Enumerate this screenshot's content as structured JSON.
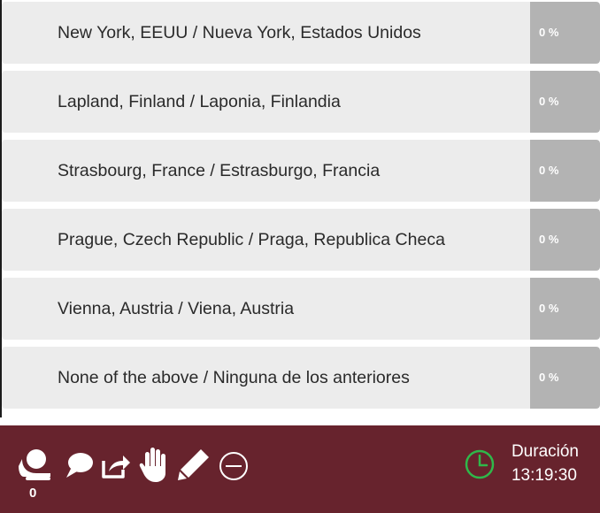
{
  "options": [
    {
      "label": "New York, EEUU / Nueva York, Estados Unidos",
      "percent_text": "0 %",
      "percent_value": 0
    },
    {
      "label": "Lapland, Finland / Laponia, Finlandia",
      "percent_text": "0 %",
      "percent_value": 0
    },
    {
      "label": "Strasbourg, France / Estrasburgo, Francia",
      "percent_text": "0 %",
      "percent_value": 0
    },
    {
      "label": "Prague, Czech Republic / Praga, Republica Checa",
      "percent_text": "0 %",
      "percent_value": 0
    },
    {
      "label": "Vienna, Austria / Viena, Austria",
      "percent_text": "0 %",
      "percent_value": 0
    },
    {
      "label": "None of the above / Ninguna de los anteriores",
      "percent_text": "0 %",
      "percent_value": 0
    }
  ],
  "toolbar": {
    "participants_count": "0",
    "icons": [
      "participants-icon",
      "chat-icon",
      "share-icon",
      "raise-hand-icon",
      "pencil-icon",
      "minus-circle-icon"
    ],
    "duration_label": "Duración",
    "duration_time": "13:19:30"
  },
  "colors": {
    "toolbar_background": "#67232d",
    "option_background": "#ececec",
    "percent_background": "#b3b3b3",
    "clock_accent": "#2fb84a"
  }
}
